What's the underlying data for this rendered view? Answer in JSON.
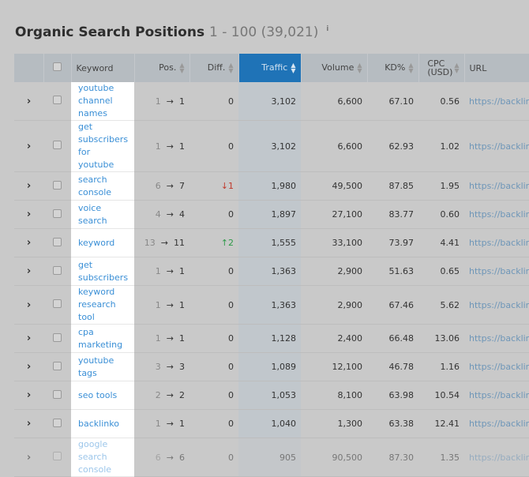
{
  "title": {
    "text": "Organic Search Positions",
    "range": "1 - 100 (39,021)",
    "info_icon": "i"
  },
  "columns": [
    "Keyword",
    "Pos.",
    "Diff.",
    "Traffic",
    "Volume",
    "KD%",
    "CPC (USD)",
    "URL"
  ],
  "accent": "#1f73b7",
  "rows": [
    {
      "keyword": "youtube channel names",
      "from": "1",
      "to": "1",
      "diff": "0",
      "dir": "",
      "traffic": "3,102",
      "volume": "6,600",
      "kd": "67.10",
      "cpc": "0.56",
      "url": "https://backlinko"
    },
    {
      "keyword": "get subscribers for youtube",
      "from": "1",
      "to": "1",
      "diff": "0",
      "dir": "",
      "traffic": "3,102",
      "volume": "6,600",
      "kd": "62.93",
      "cpc": "1.02",
      "url": "https://backlinko"
    },
    {
      "keyword": "search console",
      "from": "6",
      "to": "7",
      "diff": "1",
      "dir": "down",
      "traffic": "1,980",
      "volume": "49,500",
      "kd": "87.85",
      "cpc": "1.95",
      "url": "https://backlinko"
    },
    {
      "keyword": "voice search",
      "from": "4",
      "to": "4",
      "diff": "0",
      "dir": "",
      "traffic": "1,897",
      "volume": "27,100",
      "kd": "83.77",
      "cpc": "0.60",
      "url": "https://backlinko"
    },
    {
      "keyword": "keyword",
      "from": "13",
      "to": "11",
      "diff": "2",
      "dir": "up",
      "traffic": "1,555",
      "volume": "33,100",
      "kd": "73.97",
      "cpc": "4.41",
      "url": "https://backlinko"
    },
    {
      "keyword": "get subscribers",
      "from": "1",
      "to": "1",
      "diff": "0",
      "dir": "",
      "traffic": "1,363",
      "volume": "2,900",
      "kd": "51.63",
      "cpc": "0.65",
      "url": "https://backlinko"
    },
    {
      "keyword": "keyword research tool",
      "from": "1",
      "to": "1",
      "diff": "0",
      "dir": "",
      "traffic": "1,363",
      "volume": "2,900",
      "kd": "67.46",
      "cpc": "5.62",
      "url": "https://backlinko"
    },
    {
      "keyword": "cpa marketing",
      "from": "1",
      "to": "1",
      "diff": "0",
      "dir": "",
      "traffic": "1,128",
      "volume": "2,400",
      "kd": "66.48",
      "cpc": "13.06",
      "url": "https://backlinko"
    },
    {
      "keyword": "youtube tags",
      "from": "3",
      "to": "3",
      "diff": "0",
      "dir": "",
      "traffic": "1,089",
      "volume": "12,100",
      "kd": "46.78",
      "cpc": "1.16",
      "url": "https://backlinko"
    },
    {
      "keyword": "seo tools",
      "from": "2",
      "to": "2",
      "diff": "0",
      "dir": "",
      "traffic": "1,053",
      "volume": "8,100",
      "kd": "63.98",
      "cpc": "10.54",
      "url": "https://backlinko"
    },
    {
      "keyword": "backlinko",
      "from": "1",
      "to": "1",
      "diff": "0",
      "dir": "",
      "traffic": "1,040",
      "volume": "1,300",
      "kd": "63.38",
      "cpc": "12.41",
      "url": "https://backlinko"
    },
    {
      "keyword": "google search console",
      "from": "6",
      "to": "6",
      "diff": "0",
      "dir": "",
      "traffic": "905",
      "volume": "90,500",
      "kd": "87.30",
      "cpc": "1.35",
      "url": "https://backlinko"
    }
  ]
}
